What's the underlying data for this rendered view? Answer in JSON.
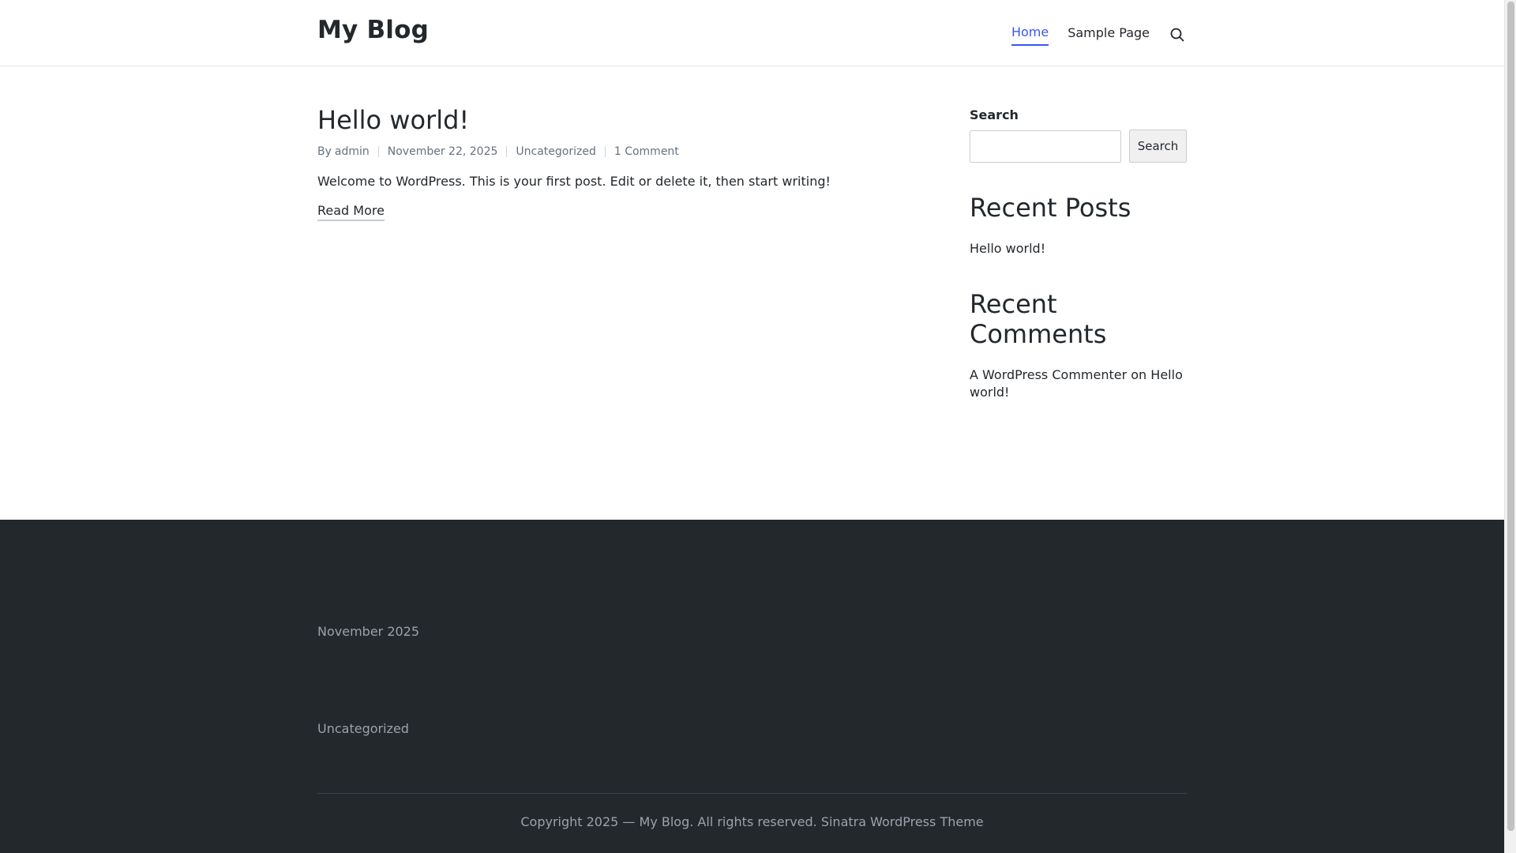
{
  "header": {
    "site_title": "My Blog",
    "nav": [
      {
        "label": "Home",
        "active": true
      },
      {
        "label": "Sample Page",
        "active": false
      }
    ],
    "search_icon": "search-icon"
  },
  "post": {
    "title": "Hello world!",
    "meta": {
      "by_prefix": "By",
      "author": "admin",
      "date": "November 22, 2025",
      "category": "Uncategorized",
      "comments": "1 Comment"
    },
    "excerpt": "Welcome to WordPress. This is your first post. Edit or delete it, then start writing!",
    "read_more": "Read More"
  },
  "sidebar": {
    "search": {
      "label": "Search",
      "input_value": "",
      "button_label": "Search"
    },
    "recent_posts": {
      "title": "Recent Posts",
      "items": [
        "Hello world!"
      ]
    },
    "recent_comments": {
      "title": "Recent Comments",
      "author": "A WordPress Commenter",
      "on_text": "on",
      "post": "Hello world!"
    }
  },
  "footer": {
    "archive": "November 2025",
    "category": "Uncategorized",
    "copyright_text": "Copyright 2025 — ",
    "copyright_site": "My Blog",
    "copyright_rest": ". All rights reserved. ",
    "theme_link": "Sinatra WordPress Theme"
  },
  "colors": {
    "accent": "#3857f1",
    "text": "#23282d",
    "footer_bg": "#23282d",
    "muted": "#66717f"
  }
}
